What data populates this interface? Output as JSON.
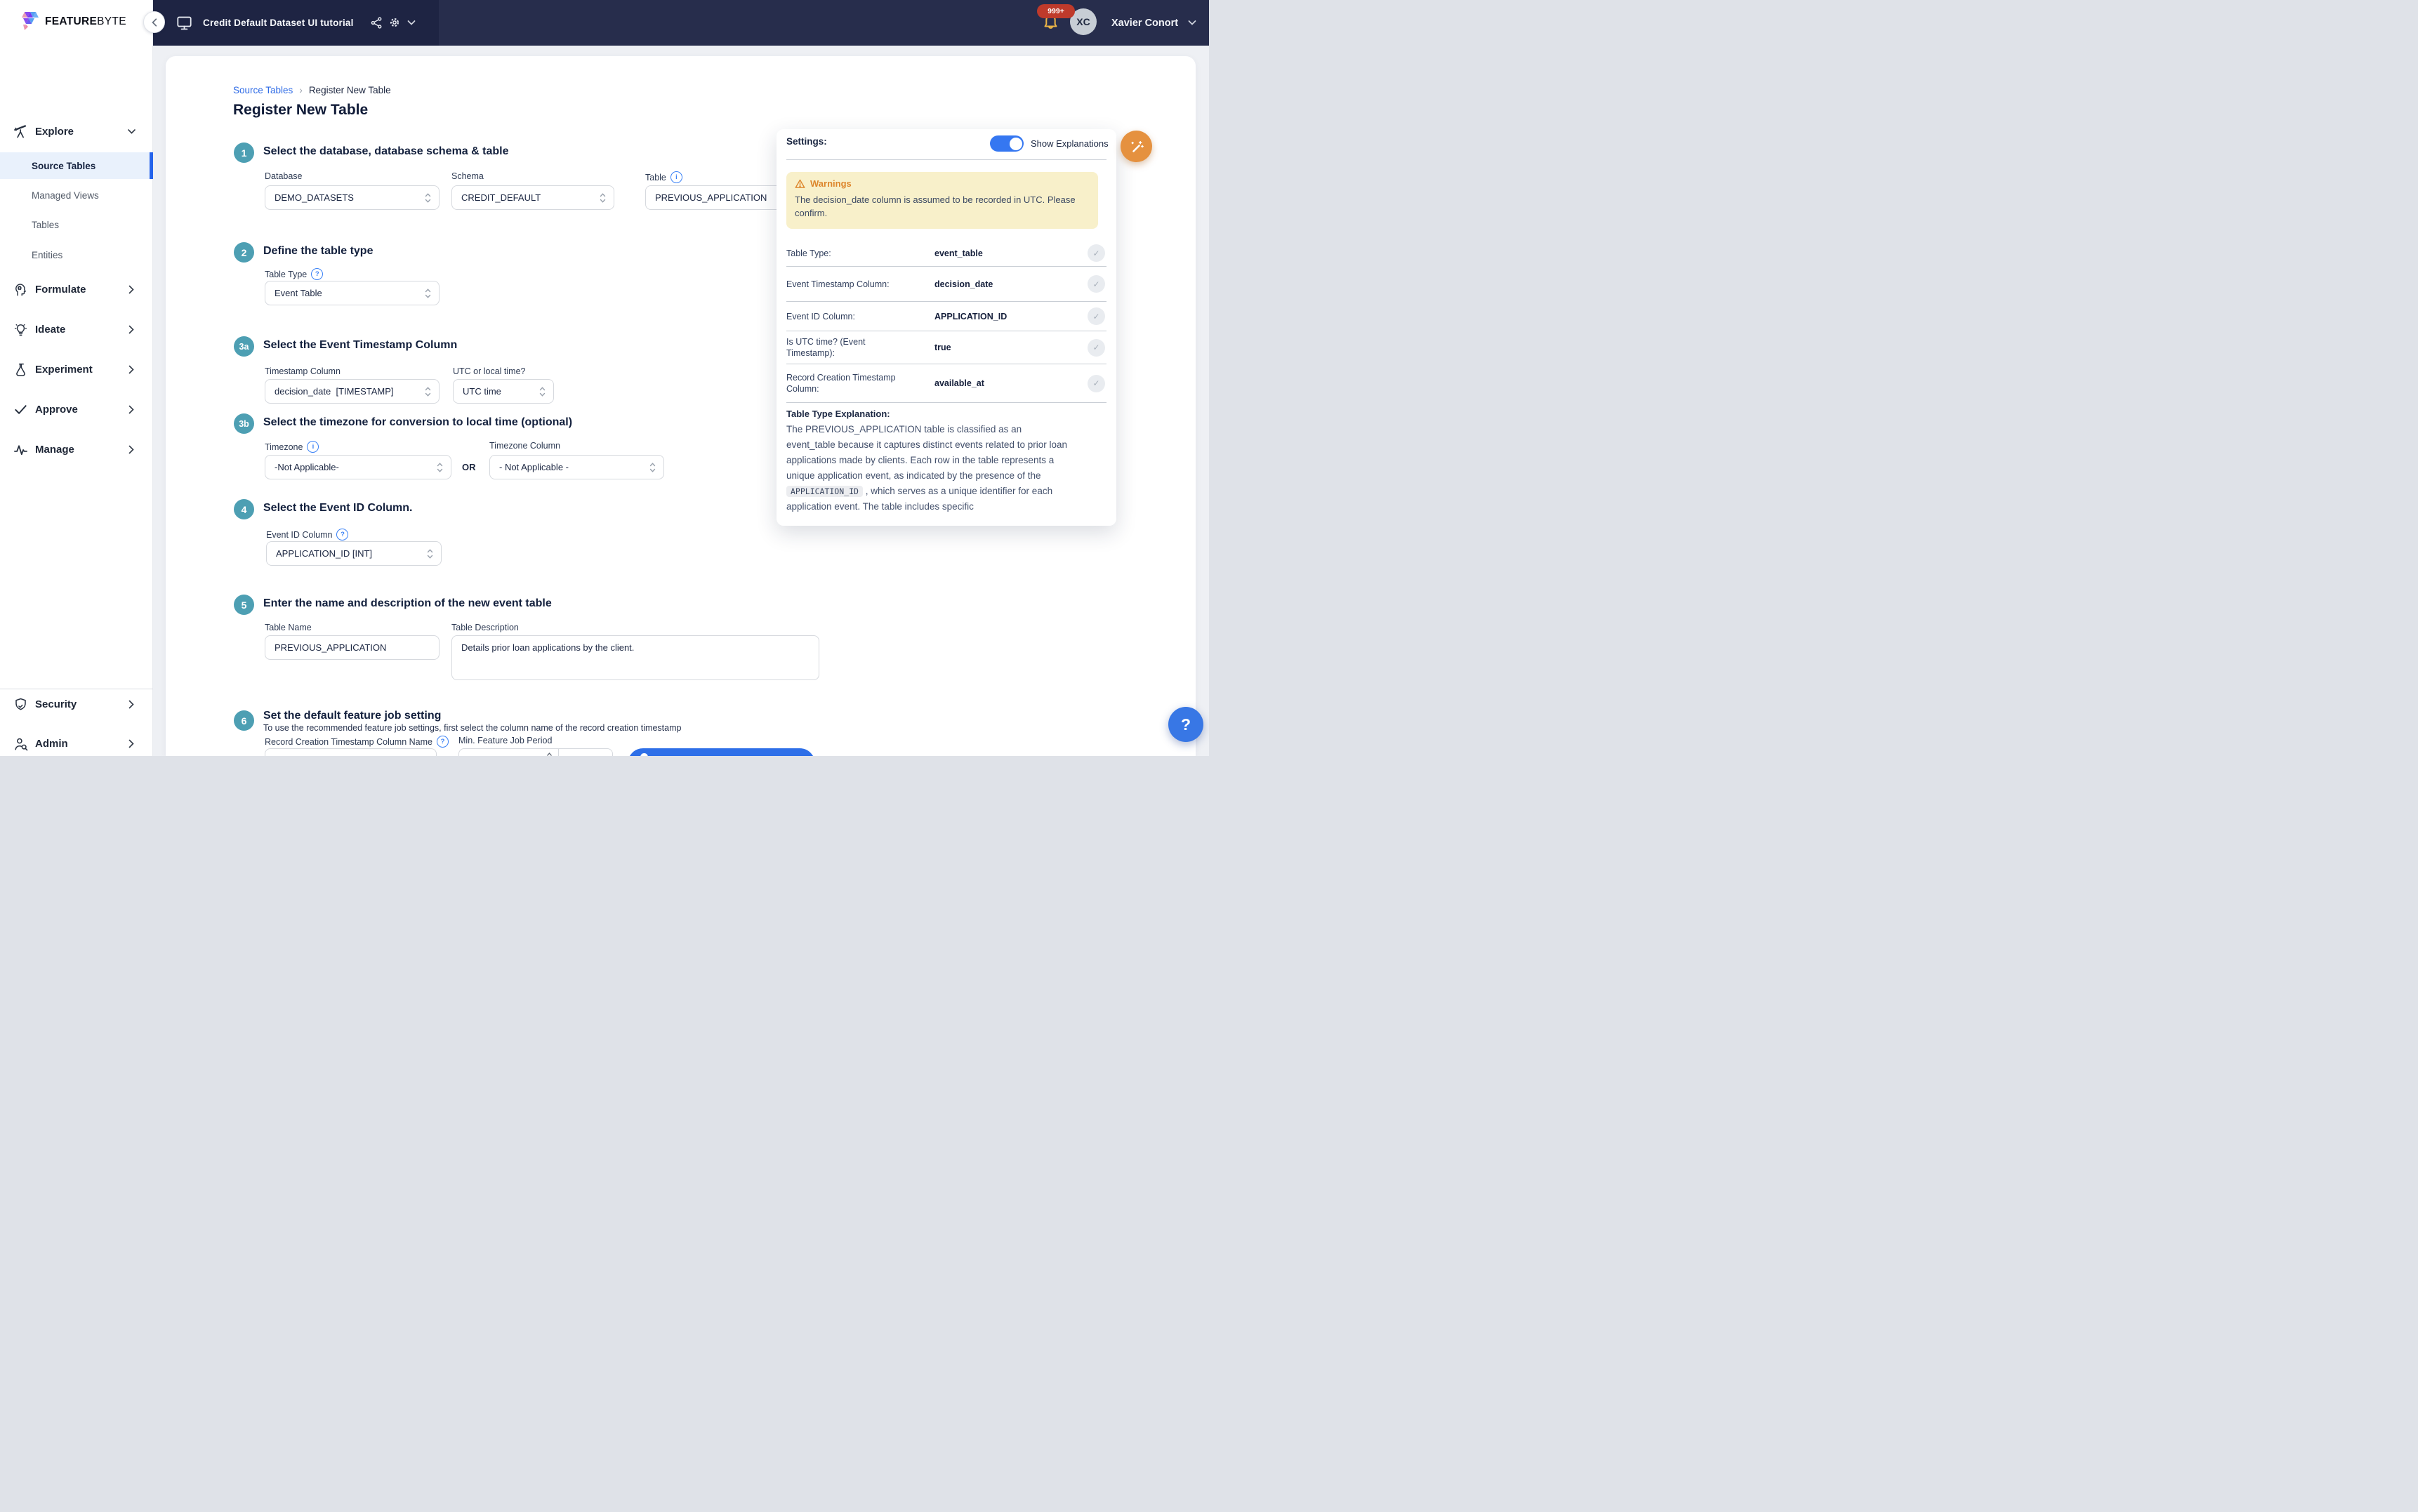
{
  "logo": {
    "bold": "FEATURE",
    "light": "BYTE"
  },
  "topbar": {
    "project_title": "Credit Default Dataset UI tutorial",
    "notifications_badge": "999+",
    "user_initials": "XC",
    "user_name": "Xavier Conort"
  },
  "sidebar": {
    "explore": {
      "label": "Explore",
      "items": [
        "Source Tables",
        "Managed Views",
        "Tables",
        "Entities"
      ]
    },
    "sections": [
      "Formulate",
      "Ideate",
      "Experiment",
      "Approve",
      "Manage"
    ],
    "bottom": [
      "Security",
      "Admin"
    ]
  },
  "breadcrumb": {
    "parent": "Source Tables",
    "separator": "›",
    "current": "Register New Table"
  },
  "page": {
    "title": "Register New Table"
  },
  "icons": {
    "info": "i",
    "help": "?",
    "check": "✓"
  },
  "steps": {
    "s1": {
      "num": "1",
      "title": "Select the database, database schema & table",
      "database_label": "Database",
      "database_value": "DEMO_DATASETS",
      "schema_label": "Schema",
      "schema_value": "CREDIT_DEFAULT",
      "table_label": "Table",
      "table_value": "PREVIOUS_APPLICATION"
    },
    "s2": {
      "num": "2",
      "title": "Define the table type",
      "type_label": "Table Type",
      "type_value": "Event Table"
    },
    "s3a": {
      "num": "3a",
      "title": "Select the Event Timestamp Column",
      "ts_label": "Timestamp Column",
      "ts_value": "decision_date  [TIMESTAMP]",
      "utc_label": "UTC or local time?",
      "utc_value": "UTC time"
    },
    "s3b": {
      "num": "3b",
      "title": "Select the timezone for conversion to local time (optional)",
      "tz_label": "Timezone",
      "tz_value": "-Not Applicable-",
      "or": "OR",
      "tzcol_label": "Timezone Column",
      "tzcol_value": "- Not Applicable -"
    },
    "s4": {
      "num": "4",
      "title": "Select the Event ID Column.",
      "id_label": "Event ID Column",
      "id_value": "APPLICATION_ID [INT]"
    },
    "s5": {
      "num": "5",
      "title": "Enter the name and description of the new event table",
      "name_label": "Table Name",
      "name_value": "PREVIOUS_APPLICATION",
      "desc_label": "Table Description",
      "desc_value": "Details prior loan applications by the client."
    },
    "s6": {
      "num": "6",
      "title": "Set the default feature job setting",
      "subtitle": "To use the recommended feature job settings, first select the column name of the record creation timestamp",
      "rc_label": "Record Creation Timestamp Column Name",
      "period_label": "Min. Feature Job Period"
    }
  },
  "settings_panel": {
    "title": "Settings:",
    "toggle_label": "Show Explanations",
    "warning_title": "Warnings",
    "warning_text": "The decision_date column is assumed to be recorded in UTC. Please confirm.",
    "rows": [
      {
        "label": "Table Type:",
        "value": "event_table"
      },
      {
        "label": "Event Timestamp Column:",
        "value": "decision_date"
      },
      {
        "label": "Event ID Column:",
        "value": "APPLICATION_ID"
      },
      {
        "label": "Is UTC time? (Event Timestamp):",
        "value": "true"
      },
      {
        "label": "Record Creation Timestamp Column:",
        "value": "available_at"
      }
    ],
    "explanation_title": "Table Type Explanation:",
    "explanation_before": "The PREVIOUS_APPLICATION table is classified as an event_table because it captures distinct events related to prior loan applications made by clients. Each row in the table represents a unique application event, as indicated by the presence of the ",
    "explanation_code": "APPLICATION_ID",
    "explanation_after": " , which serves as a unique identifier for each application event. The table includes specific"
  },
  "colors": {
    "accent_blue": "#2e6be6",
    "step_teal": "#4d9fb3",
    "topbar_navy": "#272d4c",
    "warning_bg": "#f8f0ca",
    "warning_orange": "#dd862c",
    "wand_orange": "#e5913f",
    "active_item_bg": "#e9f1fc",
    "active_bar": "#2563eb"
  }
}
